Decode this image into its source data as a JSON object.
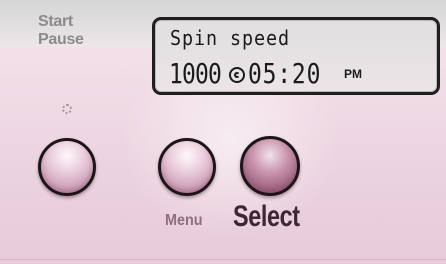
{
  "controls": {
    "start_pause": {
      "line1": "Start",
      "line2": "Pause"
    },
    "menu_label": "Menu",
    "select_label": "Select"
  },
  "display": {
    "title": "Spin speed",
    "spin_value": "1000",
    "time": "05:20",
    "ampm": "PM",
    "spin_icon": "spin-swirl-icon"
  },
  "status_icon": "spinner-icon",
  "colors": {
    "panel_pink": "#ecd4e0",
    "lcd_background": "#e4e0e2",
    "lcd_text": "#1b1b1b",
    "select_label": "#3f2634",
    "menu_label": "#8d6f80",
    "start_pause_label": "#8c8a8c"
  }
}
